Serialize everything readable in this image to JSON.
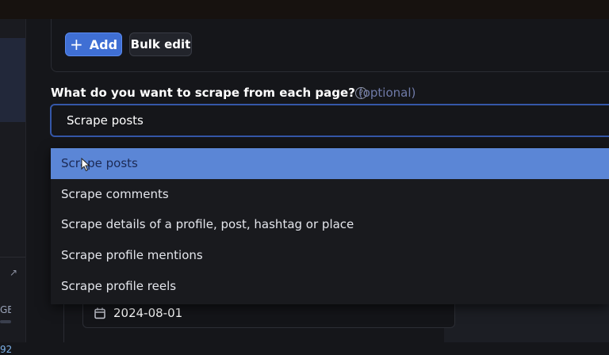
{
  "toolbar": {
    "add_label": "Add",
    "bulk_edit_label": "Bulk edit"
  },
  "question": {
    "label": "What do you want to scrape from each page?",
    "optional": "(optional)"
  },
  "select": {
    "value": "Scrape posts"
  },
  "dropdown": {
    "options": [
      "Scrape posts",
      "Scrape comments",
      "Scrape details of a profile, post, hashtag or place",
      "Scrape profile mentions",
      "Scrape profile reels"
    ],
    "selected_index": 0
  },
  "date_field": {
    "value": "2024-08-01"
  },
  "sidebar": {
    "storage_unit": "GB",
    "count": "92"
  },
  "colors": {
    "accent": "#3f6fd4",
    "highlight": "#5b86d6"
  }
}
